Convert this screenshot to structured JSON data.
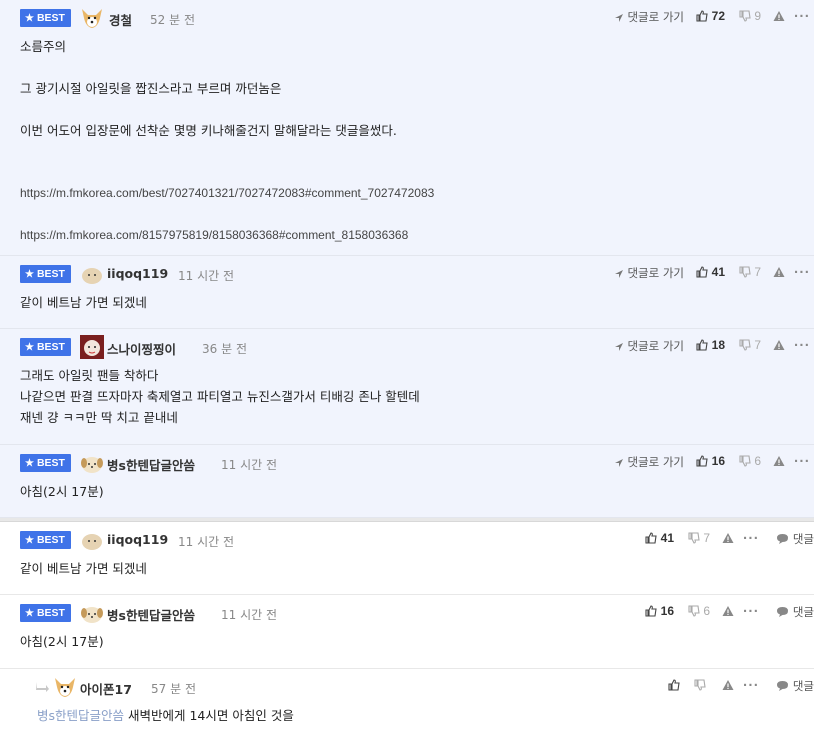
{
  "best_label": "BEST",
  "best_comments": [
    {
      "nick": "경철",
      "time": "52 분 전",
      "goto_label": "댓글로 가기",
      "likes": "72",
      "dislikes": "9",
      "lines": [
        "소름주의",
        "",
        "그 광기시절 아일릿을 짭진스라고 부르며 까던놈은",
        "",
        "이번 어도어 입장문에 선착순 몇명 키나해줄건지 말해달라는 댓글을썼다.",
        "",
        ""
      ],
      "urls": [
        "https://m.fmkorea.com/best/7027401321/7027472083#comment_7027472083",
        "https://m.fmkorea.com/8157975819/8158036368#comment_8158036368"
      ]
    },
    {
      "nick": "iiqoq119",
      "time": "11 시간 전",
      "goto_label": "댓글로 가기",
      "likes": "41",
      "dislikes": "7",
      "lines": [
        "같이 베트남 가면 되겠네"
      ]
    },
    {
      "nick": "스나이찡찡이",
      "time": "36 분 전",
      "goto_label": "댓글로 가기",
      "likes": "18",
      "dislikes": "7",
      "lines": [
        "그래도 아일릿 팬들 착하다",
        "나같으면 판결 뜨자마자 축제열고 파티열고 뉴진스갤가서 티배깅 존나 할텐데",
        "재넨 걍 ㅋㅋ만 딱 치고 끝내네"
      ]
    },
    {
      "nick": "병s한텐답글안씀",
      "time": "11 시간 전",
      "goto_label": "댓글로 가기",
      "likes": "16",
      "dislikes": "6",
      "lines": [
        "아침(2시 17분)"
      ]
    }
  ],
  "plain_comments": [
    {
      "nick": "iiqoq119",
      "time": "11 시간 전",
      "likes": "41",
      "dislikes": "7",
      "reply_label": "댓글",
      "lines": [
        "같이 베트남 가면 되겠네"
      ]
    },
    {
      "nick": "병s한텐답글안씀",
      "time": "11 시간 전",
      "likes": "16",
      "dislikes": "6",
      "reply_label": "댓글",
      "lines": [
        "아침(2시 17분)"
      ]
    }
  ],
  "reply_comment": {
    "nick": "아이폰17",
    "time": "57 분 전",
    "reply_label": "댓글",
    "reply_to": "병s한텐답글안씀",
    "text": " 새벽반에게 14시면 아침인 것을"
  },
  "colors": {
    "best_bg": "#f1f4fd",
    "badge": "#3f73e8"
  },
  "icons": [
    "star-icon",
    "arrow-icon",
    "thumb-up-icon",
    "thumb-down-icon",
    "warning-icon",
    "more-icon",
    "speech-bubble-icon",
    "reply-arrow-icon"
  ]
}
